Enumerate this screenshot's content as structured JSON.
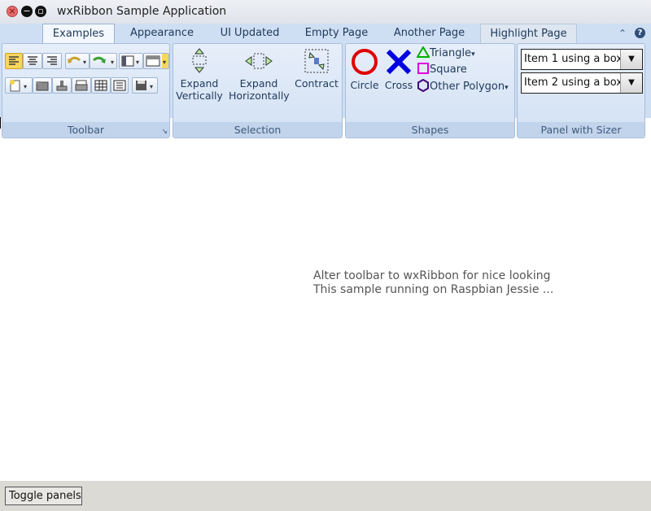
{
  "window": {
    "title": "wxRibbon Sample Application"
  },
  "tabs": [
    {
      "label": "Examples",
      "active": true
    },
    {
      "label": "Appearance"
    },
    {
      "label": "UI Updated"
    },
    {
      "label": "Empty Page"
    },
    {
      "label": "Another Page"
    },
    {
      "label": "Highlight Page",
      "highlighted": true
    }
  ],
  "panels": {
    "toolbar": {
      "label": "Toolbar"
    },
    "selection": {
      "label": "Selection",
      "buttons": [
        {
          "label": "Expand Vertically",
          "line1": "Expand",
          "line2": "Vertically"
        },
        {
          "label": "Expand Horizontally",
          "line1": "Expand",
          "line2": "Horizontally"
        },
        {
          "label": "Contract"
        }
      ]
    },
    "shapes": {
      "label": "Shapes",
      "circle": "Circle",
      "cross": "Cross",
      "triangle": "Triangle",
      "square": "Square",
      "other_polygon": "Other Polygon"
    },
    "sizer": {
      "label": "Panel with Sizer",
      "combo1": "Item 1 using a box",
      "combo2": "Item 2 using a box"
    }
  },
  "main": {
    "line1": "Alter toolbar to wxRibbon for nice looking",
    "line2": "This sample running on Raspbian Jessie ..."
  },
  "statusbar": {
    "toggle_label": "Toggle panels"
  },
  "colors": {
    "ribbon_bg": "#cfdff3",
    "circle": "#e00000",
    "cross": "#0000e0",
    "triangle": "#00b000",
    "square": "#e000e0",
    "polygon": "#400080"
  }
}
